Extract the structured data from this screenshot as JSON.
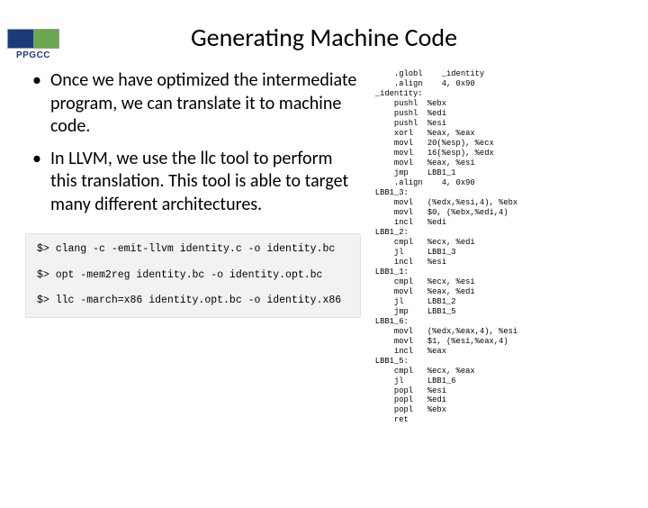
{
  "logo": {
    "label": "PPGCC",
    "sub": ""
  },
  "title": "Generating Machine Code",
  "bullets": [
    "Once we have optimized the intermediate program, we can translate it to machine code.",
    "In LLVM, we use the llc tool to perform this translation. This tool is able to target many different architectures."
  ],
  "commands": [
    "$> clang -c -emit-llvm identity.c -o identity.bc",
    "$> opt -mem2reg identity.bc -o identity.opt.bc",
    "$> llc -march=x86 identity.opt.bc -o identity.x86"
  ],
  "asm": "    .globl    _identity\n    .align    4, 0x90\n_identity:\n    pushl  %ebx\n    pushl  %edi\n    pushl  %esi\n    xorl   %eax, %eax\n    movl   20(%esp), %ecx\n    movl   16(%esp), %edx\n    movl   %eax, %esi\n    jmp    LBB1_1\n    .align    4, 0x90\nLBB1_3:\n    movl   (%edx,%esi,4), %ebx\n    movl   $0, (%ebx,%edi,4)\n    incl   %edi\nLBB1_2:\n    cmpl   %ecx, %edi\n    jl     LBB1_3\n    incl   %esi\nLBB1_1:\n    cmpl   %ecx, %esi\n    movl   %eax, %edi\n    jl     LBB1_2\n    jmp    LBB1_5\nLBB1_6:\n    movl   (%edx,%eax,4), %esi\n    movl   $1, (%esi,%eax,4)\n    incl   %eax\nLBB1_5:\n    cmpl   %ecx, %eax\n    jl     LBB1_6\n    popl   %esi\n    popl   %edi\n    popl   %ebx\n    ret"
}
